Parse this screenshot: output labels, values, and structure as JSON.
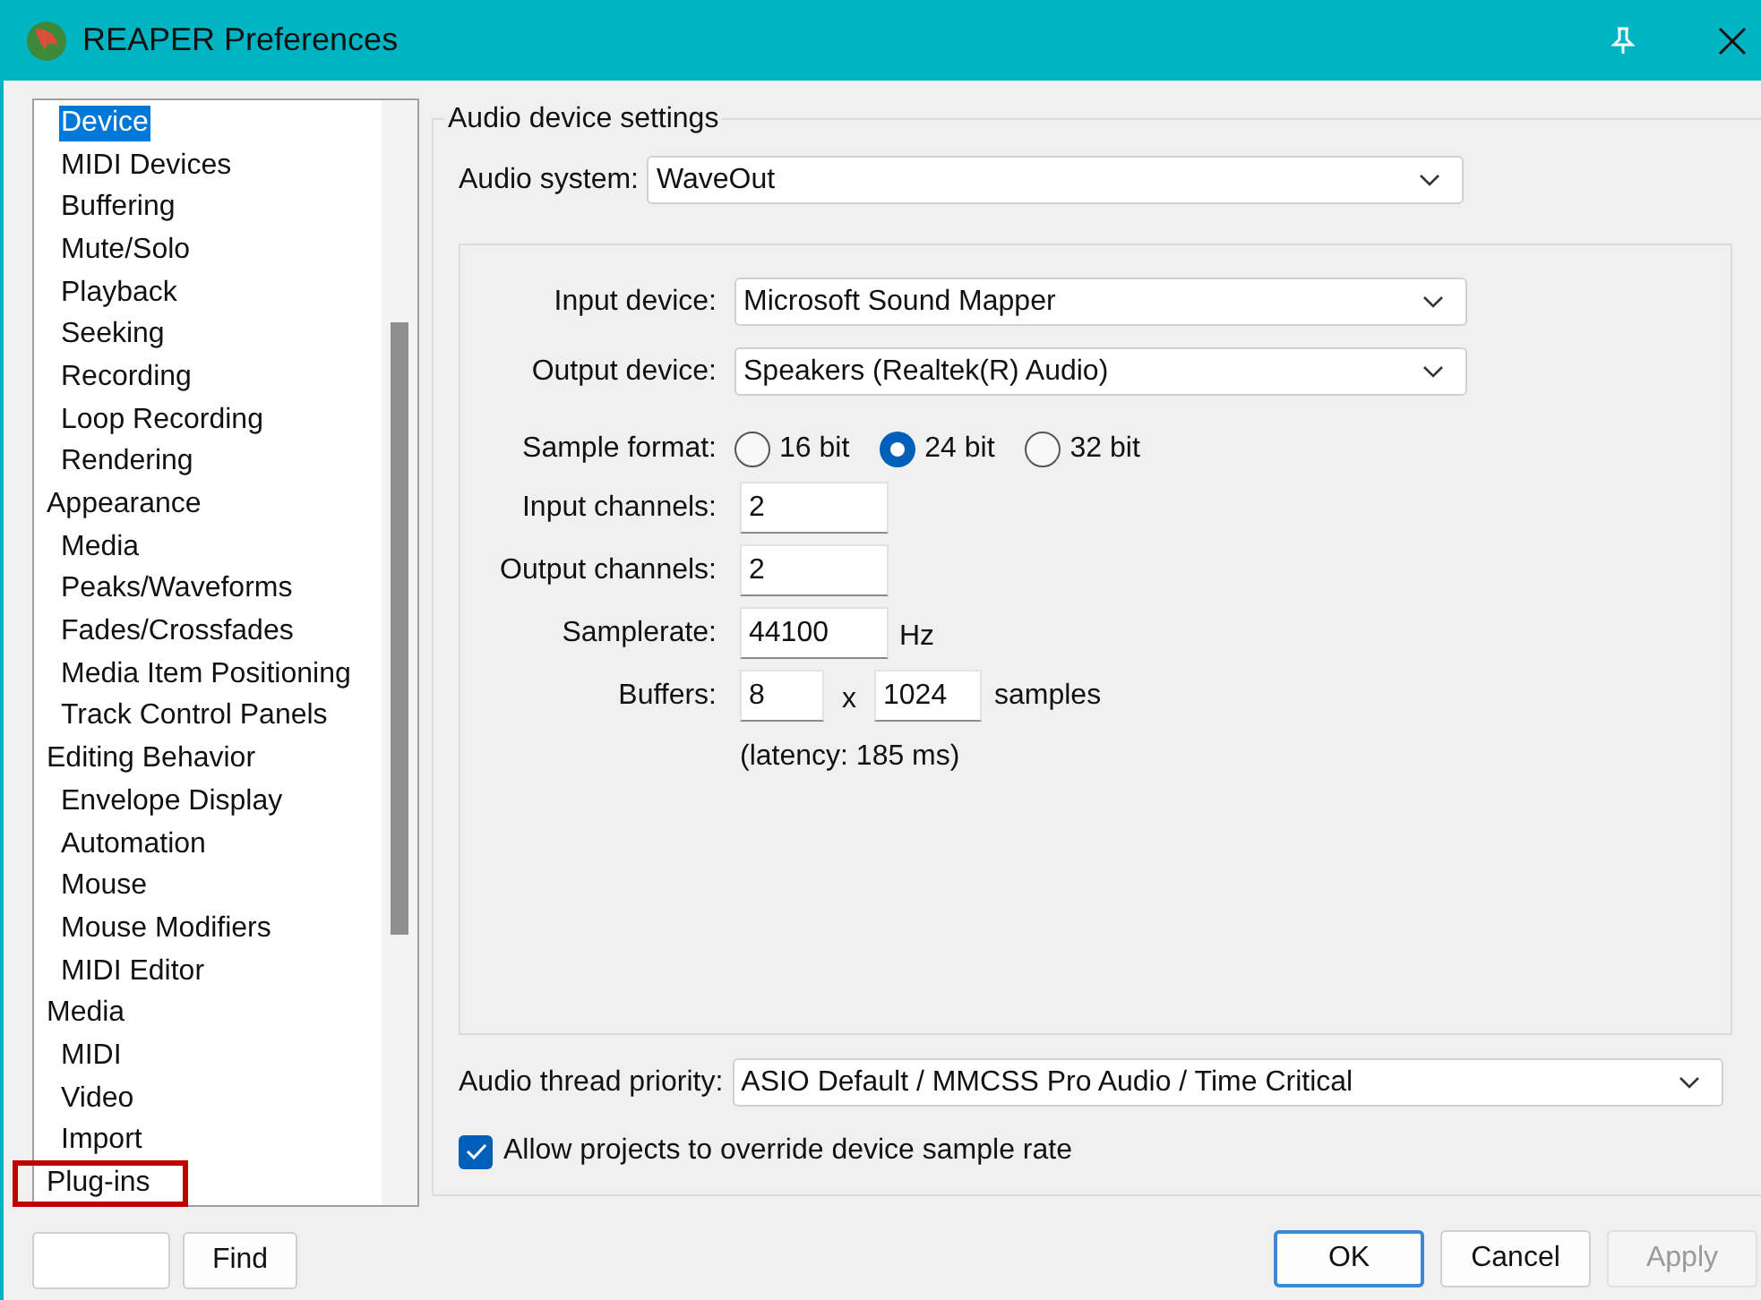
{
  "window": {
    "title": "REAPER Preferences"
  },
  "tree": [
    {
      "children": [
        {
          "label": "Device",
          "selected": true
        },
        {
          "label": "MIDI Devices",
          "selected": false
        },
        {
          "label": "Buffering",
          "selected": false
        },
        {
          "label": "Mute/Solo",
          "selected": false
        },
        {
          "label": "Playback",
          "selected": false
        },
        {
          "label": "Seeking",
          "selected": false
        },
        {
          "label": "Recording",
          "selected": false
        },
        {
          "label": "Loop Recording",
          "selected": false
        },
        {
          "label": "Rendering",
          "selected": false
        }
      ]
    },
    {
      "label": "Appearance",
      "highlighted": false,
      "selected": false,
      "children": [
        {
          "label": "Media",
          "selected": false
        },
        {
          "label": "Peaks/Waveforms",
          "selected": false
        },
        {
          "label": "Fades/Crossfades",
          "selected": false
        },
        {
          "label": "Media Item Positioning",
          "selected": false
        },
        {
          "label": "Track Control Panels",
          "selected": false
        }
      ]
    },
    {
      "label": "Editing Behavior",
      "highlighted": false,
      "selected": false,
      "children": [
        {
          "label": "Envelope Display",
          "selected": false
        },
        {
          "label": "Automation",
          "selected": false
        },
        {
          "label": "Mouse",
          "selected": false
        },
        {
          "label": "Mouse Modifiers",
          "selected": false
        },
        {
          "label": "MIDI Editor",
          "selected": false
        }
      ]
    },
    {
      "label": "Media",
      "highlighted": false,
      "selected": false,
      "children": [
        {
          "label": "MIDI",
          "selected": false
        },
        {
          "label": "Video",
          "selected": false
        },
        {
          "label": "Import",
          "selected": false
        }
      ]
    },
    {
      "label": "Plug-ins",
      "highlighted": true,
      "selected": false
    }
  ],
  "find": {
    "button": "Find"
  },
  "group_title": "Audio device settings",
  "audio_system": {
    "label": "Audio system:",
    "value": "WaveOut"
  },
  "input_device": {
    "label": "Input device:",
    "value": "Microsoft Sound Mapper"
  },
  "output_device": {
    "label": "Output device:",
    "value": "Speakers (Realtek(R) Audio)"
  },
  "sample_format": {
    "label": "Sample format:",
    "options": [
      {
        "label": "16 bit",
        "selected": false
      },
      {
        "label": "24 bit",
        "selected": true
      },
      {
        "label": "32 bit",
        "selected": false
      }
    ]
  },
  "input_channels": {
    "label": "Input channels:",
    "value": "2"
  },
  "output_channels": {
    "label": "Output channels:",
    "value": "2"
  },
  "samplerate": {
    "label": "Samplerate:",
    "value": "44100",
    "unit": "Hz"
  },
  "buffers": {
    "label": "Buffers:",
    "count": "8",
    "separator": "x",
    "size": "1024",
    "unit": "samples"
  },
  "latency": "(latency: 185 ms)",
  "thread_priority": {
    "label": "Audio thread priority:",
    "value": "ASIO Default / MMCSS Pro Audio / Time Critical"
  },
  "allow_override": {
    "label": "Allow projects to override device sample rate",
    "checked": true
  },
  "buttons": [
    {
      "label": "OK",
      "disabled": false,
      "default": true
    },
    {
      "label": "Cancel",
      "disabled": false,
      "default": false
    },
    {
      "label": "Apply",
      "disabled": true,
      "default": false
    }
  ]
}
